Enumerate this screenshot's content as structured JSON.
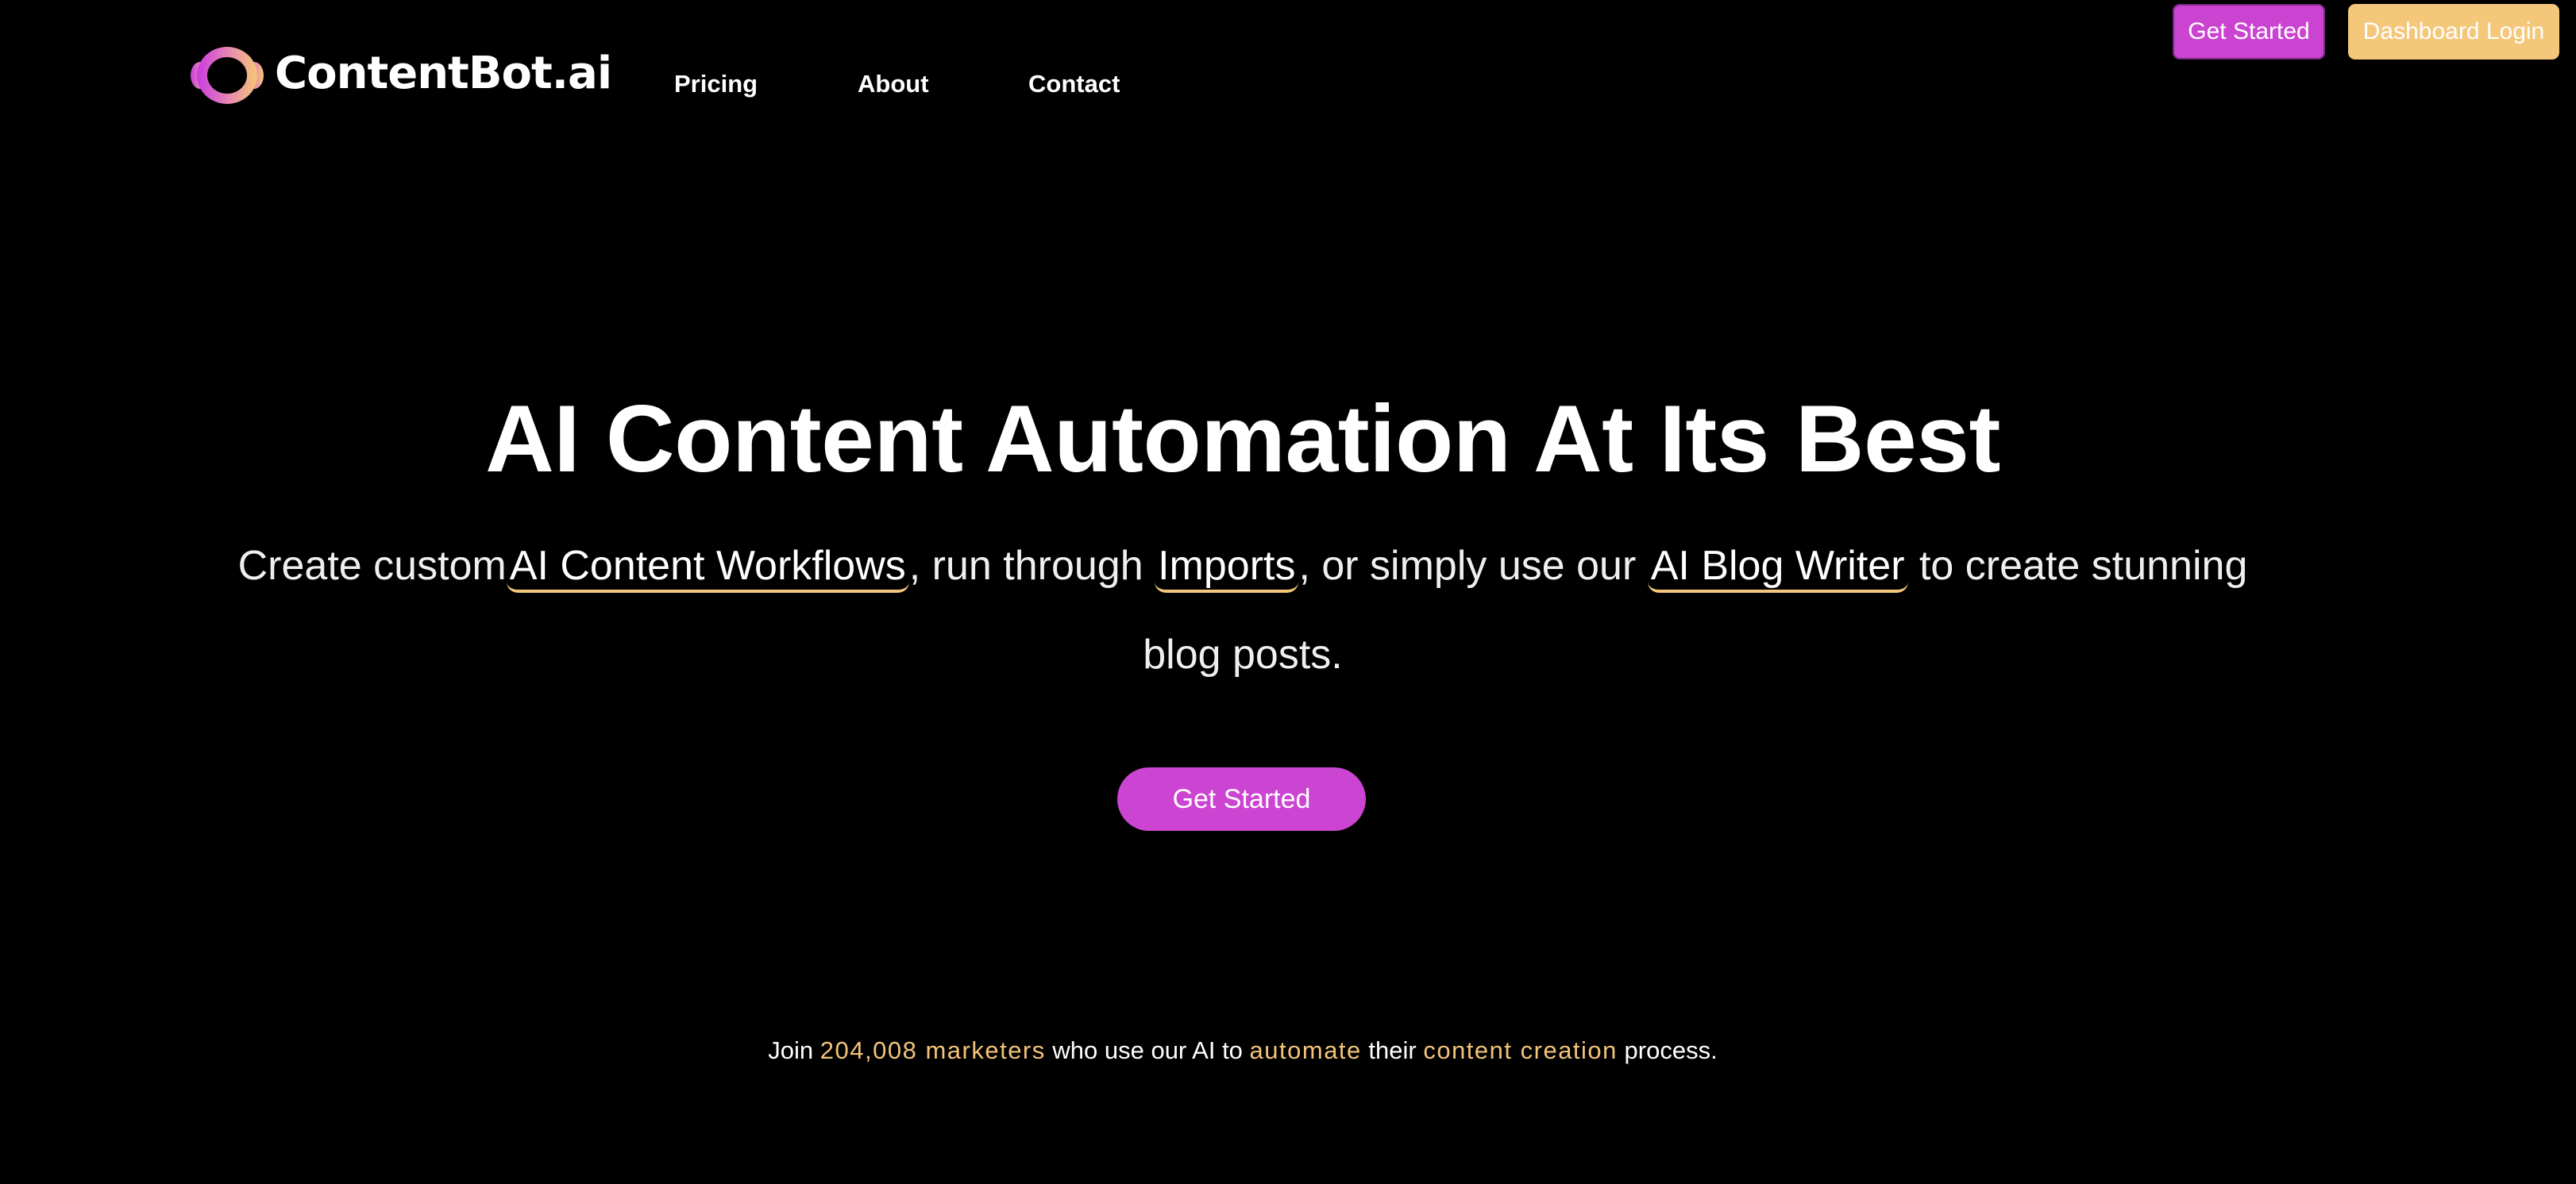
{
  "brand": {
    "name": "ContentBot.ai",
    "logo_icon": "ring-logo-icon",
    "colors": {
      "background": "#000000",
      "primary": "#cc44d2",
      "accent": "#f4c77a",
      "text": "#ffffff"
    }
  },
  "nav": {
    "items": [
      {
        "label": "Pricing"
      },
      {
        "label": "About"
      },
      {
        "label": "Contact"
      }
    ]
  },
  "header_actions": {
    "get_started": "Get Started",
    "dashboard_login": "Dashboard Login"
  },
  "hero": {
    "title": "AI Content Automation At Its Best",
    "subtitle": {
      "part1": "Create custom",
      "link1": "AI Content Workflows",
      "part2": ", run through ",
      "link2": "Imports",
      "part3": ", or simply use our ",
      "link3": "AI Blog Writer",
      "part4": " to create stunning blog posts."
    },
    "cta_label": "Get Started"
  },
  "social_proof": {
    "t1": "Join ",
    "count": "204,008 marketers",
    "t2": " who use our AI to ",
    "w1": "automate",
    "t3": " their ",
    "w2": "content creation",
    "t4": " process."
  }
}
